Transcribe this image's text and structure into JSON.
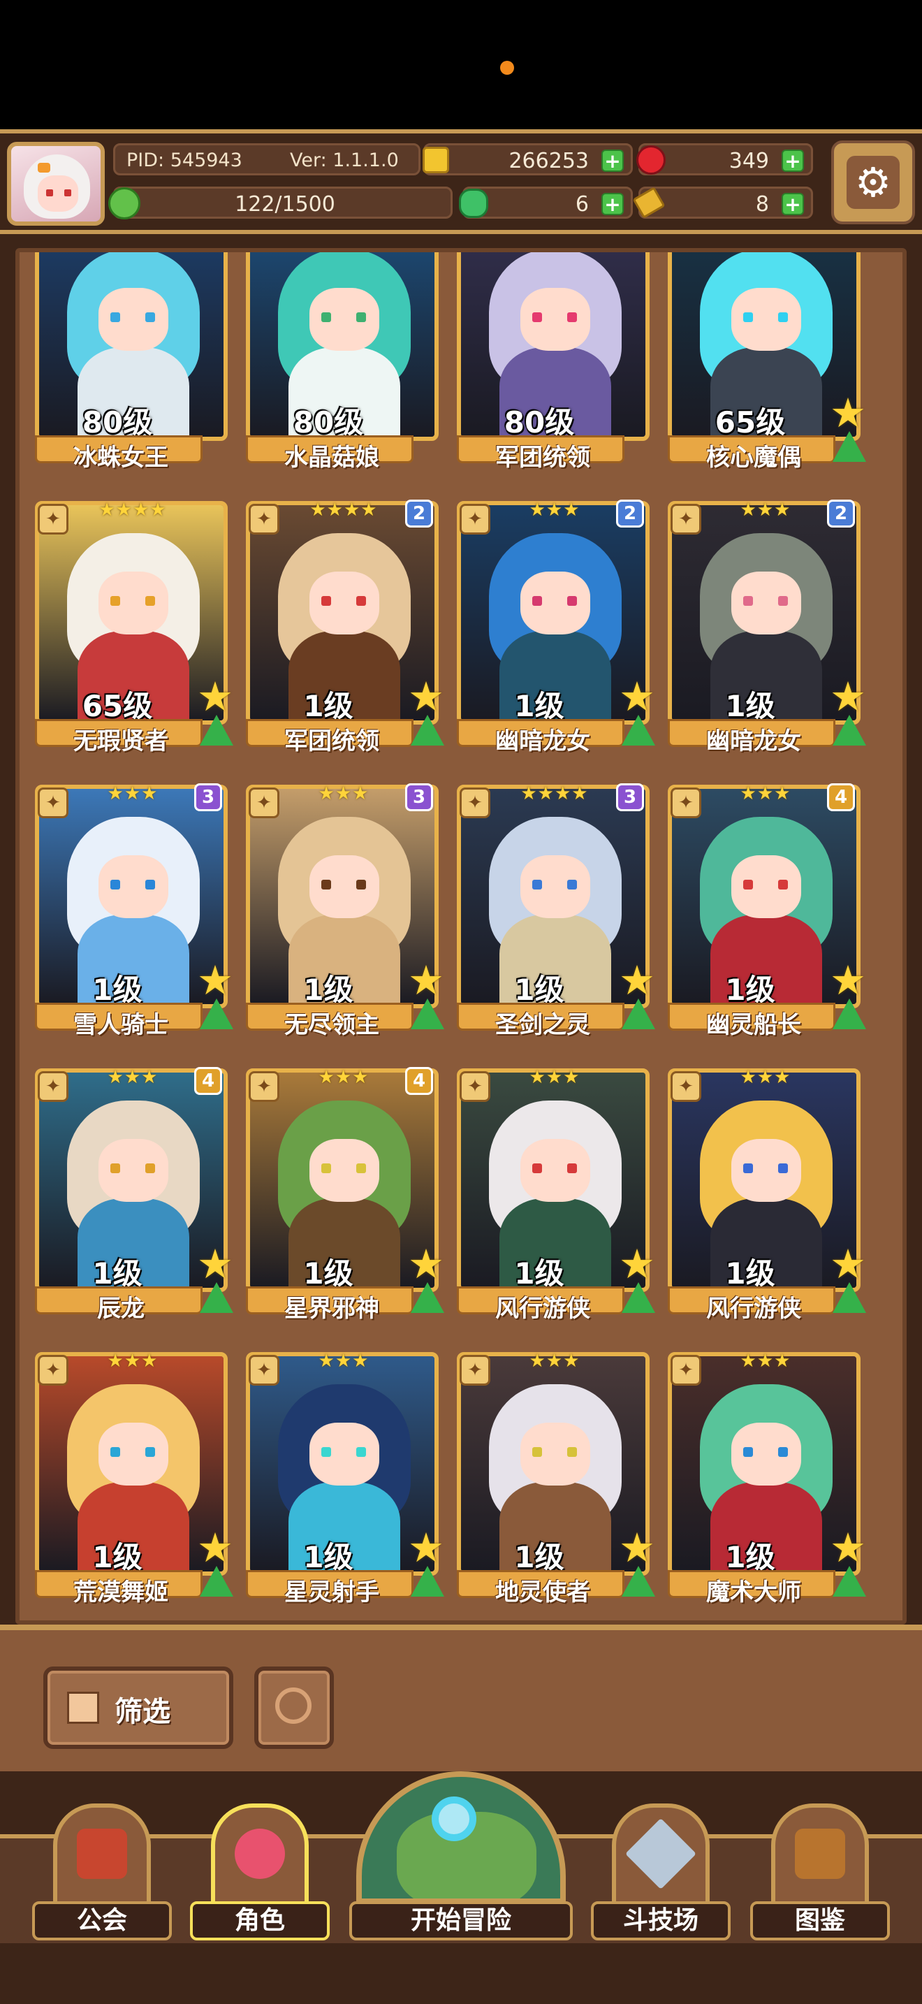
{
  "status": {
    "dot_color": "#f28a1c"
  },
  "hud": {
    "pid": "PID: 545943",
    "version": "Ver: 1.1.1.0",
    "gold": "266253",
    "gems": "349",
    "stamina": "122/1500",
    "clover": "6",
    "keys": "8",
    "plus_symbol": "+",
    "settings_symbol": "⚙"
  },
  "characters": [
    {
      "level": "80级",
      "name": "冰蛛女王",
      "stars": "",
      "rank": "",
      "hair": "#5fd0e8",
      "bg": "#1d3f6b",
      "body": "#dfe9ef",
      "eye": "#38a8e0",
      "big_star": false,
      "arrow": false
    },
    {
      "level": "80级",
      "name": "水晶菇娘",
      "stars": "",
      "rank": "",
      "hair": "#3fc8b6",
      "bg": "#1c4d7a",
      "body": "#eef6f4",
      "eye": "#3eb070",
      "big_star": false,
      "arrow": false
    },
    {
      "level": "80级",
      "name": "军团统领",
      "stars": "",
      "rank": "",
      "hair": "#c9c2e6",
      "bg": "#33304f",
      "body": "#6a5aa0",
      "eye": "#e53a6e",
      "big_star": false,
      "arrow": false
    },
    {
      "level": "65级",
      "name": "核心魔偶",
      "stars": "",
      "rank": "",
      "hair": "#52e0f0",
      "bg": "#173448",
      "body": "#3b4452",
      "eye": "#2fd0f0",
      "big_star": true,
      "arrow": true
    },
    {
      "level": "65级",
      "name": "无瑕贤者",
      "stars": "★★★★",
      "rank": "",
      "hair": "#f4efe6",
      "bg": "#e9c45a",
      "body": "#c73b3b",
      "eye": "#e6a12a",
      "big_star": true,
      "arrow": true
    },
    {
      "level": "1级",
      "name": "军团统领",
      "stars": "★★★★",
      "rank": "2",
      "hair": "#e6c69a",
      "bg": "#6a4a32",
      "body": "#6a3d22",
      "eye": "#d63a3a",
      "big_star": true,
      "arrow": true
    },
    {
      "level": "1级",
      "name": "幽暗龙女",
      "stars": "★★★",
      "rank": "2",
      "hair": "#2e7fd0",
      "bg": "#1a3d63",
      "body": "#23556e",
      "eye": "#d63a6e",
      "big_star": true,
      "arrow": true
    },
    {
      "level": "1级",
      "name": "幽暗龙女",
      "stars": "★★★",
      "rank": "2",
      "hair": "#7d867a",
      "bg": "#2e2b33",
      "body": "#2f2f38",
      "eye": "#e06a8a",
      "big_star": true,
      "arrow": true
    },
    {
      "level": "1级",
      "name": "雪人骑士",
      "stars": "★★★",
      "rank": "3",
      "hair": "#e8f0fa",
      "bg": "#3c78b8",
      "body": "#6ab0e8",
      "eye": "#2a86d8",
      "big_star": true,
      "arrow": true
    },
    {
      "level": "1级",
      "name": "无尽领主",
      "stars": "★★★",
      "rank": "3",
      "hair": "#e4c495",
      "bg": "#c49d6a",
      "body": "#d9b27f",
      "eye": "#6a3a1a",
      "big_star": true,
      "arrow": true
    },
    {
      "level": "1级",
      "name": "圣剑之灵",
      "stars": "★★★★",
      "rank": "3",
      "hair": "#c7d4e8",
      "bg": "#2b3a52",
      "body": "#d8c8a0",
      "eye": "#3a7ad6",
      "big_star": true,
      "arrow": true
    },
    {
      "level": "1级",
      "name": "幽灵船长",
      "stars": "★★★",
      "rank": "4",
      "hair": "#4fb89a",
      "bg": "#2d4b63",
      "body": "#b82a35",
      "eye": "#d63a3a",
      "big_star": true,
      "arrow": true
    },
    {
      "level": "1级",
      "name": "辰龙",
      "stars": "★★★",
      "rank": "4",
      "hair": "#e8d8c4",
      "bg": "#2f6d8a",
      "body": "#3b8fbf",
      "eye": "#e0a02a",
      "big_star": true,
      "arrow": true
    },
    {
      "level": "1级",
      "name": "星界邪神",
      "stars": "★★★",
      "rank": "4",
      "hair": "#6aa048",
      "bg": "#a97a3a",
      "body": "#6b4a2a",
      "eye": "#d8c23a",
      "big_star": true,
      "arrow": true
    },
    {
      "level": "1级",
      "name": "风行游侠",
      "stars": "★★★",
      "rank": "",
      "hair": "#ece8ea",
      "bg": "#3a4a40",
      "body": "#2e5a45",
      "eye": "#d63a3a",
      "big_star": true,
      "arrow": true
    },
    {
      "level": "1级",
      "name": "风行游侠",
      "stars": "★★★",
      "rank": "",
      "hair": "#f2c14c",
      "bg": "#2a3660",
      "body": "#2a2a35",
      "eye": "#3a6ad6",
      "big_star": true,
      "arrow": true
    },
    {
      "level": "1级",
      "name": "荒漠舞姬",
      "stars": "★★★",
      "rank": "",
      "hair": "#f4c56a",
      "bg": "#b84a2a",
      "body": "#c6402f",
      "eye": "#2aa6d6",
      "big_star": true,
      "arrow": true
    },
    {
      "level": "1级",
      "name": "星灵射手",
      "stars": "★★★",
      "rank": "",
      "hair": "#1f3a6e",
      "bg": "#2f5a8a",
      "body": "#3ab8d8",
      "eye": "#3ad6d0",
      "big_star": true,
      "arrow": true
    },
    {
      "level": "1级",
      "name": "地灵使者",
      "stars": "★★★",
      "rank": "",
      "hair": "#e6e2ea",
      "bg": "#4a3a3a",
      "body": "#8a5a3a",
      "eye": "#d6c23a",
      "big_star": true,
      "arrow": true
    },
    {
      "level": "1级",
      "name": "魔术大师",
      "stars": "★★★",
      "rank": "",
      "hair": "#58c49a",
      "bg": "#4a2e2a",
      "body": "#b82a35",
      "eye": "#2a8ad6",
      "big_star": true,
      "arrow": true
    }
  ],
  "filter": {
    "label": "筛选"
  },
  "nav": {
    "guild": "公会",
    "character": "角色",
    "adventure": "开始冒险",
    "arena": "斗技场",
    "codex": "图鉴"
  },
  "colors": {
    "rank_2": "#4a7cd6",
    "rank_3": "#8a52d0",
    "rank_4": "#e0a02a"
  }
}
